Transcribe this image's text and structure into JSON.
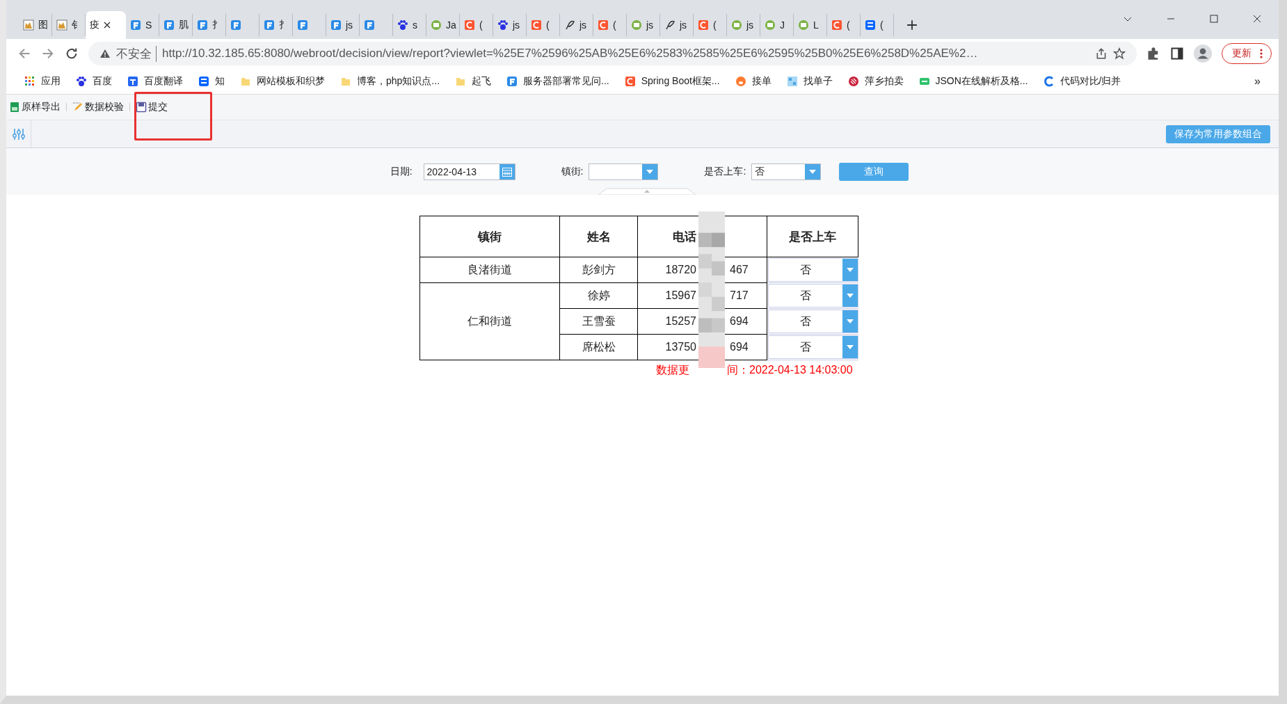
{
  "browser": {
    "tabs": [
      {
        "kind": "tomcat",
        "title": "图",
        "selected": false
      },
      {
        "kind": "tomcat",
        "title": "钅",
        "selected": false
      },
      {
        "title": "疫",
        "selected": true
      },
      {
        "kind": "fine",
        "title": "S",
        "selected": false
      },
      {
        "kind": "fine",
        "title": "肌",
        "selected": false
      },
      {
        "kind": "fine",
        "title": "扌",
        "selected": false
      },
      {
        "kind": "fine",
        "selected": false
      },
      {
        "kind": "fine",
        "title": "扌",
        "selected": false
      },
      {
        "kind": "fine",
        "selected": false
      },
      {
        "kind": "fine",
        "title": "js",
        "selected": false
      },
      {
        "kind": "fine",
        "selected": false
      },
      {
        "kind": "baidu",
        "title": "s",
        "selected": false
      },
      {
        "kind": "code",
        "title": "Ja",
        "selected": false
      },
      {
        "kind": "csdn",
        "title": "(",
        "selected": false
      },
      {
        "kind": "baidu",
        "title": "js",
        "selected": false
      },
      {
        "kind": "csdn",
        "title": "(",
        "selected": false
      },
      {
        "kind": "feather",
        "title": "js",
        "selected": false
      },
      {
        "kind": "csdn",
        "title": "(",
        "selected": false
      },
      {
        "kind": "code",
        "title": "js",
        "selected": false
      },
      {
        "kind": "feather",
        "title": "js",
        "selected": false
      },
      {
        "kind": "csdn",
        "title": "(",
        "selected": false
      },
      {
        "kind": "code",
        "title": "js",
        "selected": false
      },
      {
        "kind": "code",
        "title": "J",
        "selected": false
      },
      {
        "kind": "code",
        "title": "L",
        "selected": false
      },
      {
        "kind": "csdn",
        "title": "(",
        "selected": false
      },
      {
        "kind": "zhihu",
        "title": "(",
        "selected": false
      }
    ],
    "address_bar": {
      "security": "不安全",
      "url": "http://10.32.185.65:8080/webroot/decision/view/report?viewlet=%25E7%2596%25AB%25E6%2583%2585%25E6%2595%25B0%25E6%258D%25AE%2…"
    },
    "update_button": "更新",
    "bookmarks": [
      {
        "kind": "apps",
        "label": "应用"
      },
      {
        "kind": "baidu",
        "label": "百度"
      },
      {
        "kind": "translate",
        "label": "百度翻译"
      },
      {
        "kind": "zhihu",
        "label": "知"
      },
      {
        "kind": "folder",
        "label": "网站模板和织梦"
      },
      {
        "kind": "folder",
        "label": "博客，php知识点..."
      },
      {
        "kind": "folder",
        "label": "起飞"
      },
      {
        "kind": "fine",
        "label": "服务器部署常见问..."
      },
      {
        "kind": "csdn",
        "label": "Spring Boot框架..."
      },
      {
        "kind": "pig",
        "label": "接单"
      },
      {
        "kind": "grid",
        "label": "找单子"
      },
      {
        "kind": "auction",
        "label": "萍乡拍卖"
      },
      {
        "kind": "json",
        "label": "JSON在线解析及格..."
      },
      {
        "kind": "compare",
        "label": "代码对比/归并"
      }
    ],
    "bookmarks_overflow": "»"
  },
  "report": {
    "toolbar": [
      {
        "kind": "excel",
        "label": "原样导出"
      },
      {
        "kind": "pencil",
        "label": "数据校验"
      },
      {
        "kind": "save",
        "label": "提交"
      }
    ],
    "save_params_button": "保存为常用参数组合",
    "params": {
      "date": {
        "label": "日期:",
        "value": "2022-04-13"
      },
      "town": {
        "label": "镇街:"
      },
      "on_bus": {
        "label": "是否上车:",
        "value": "否"
      },
      "query_button": "查询"
    },
    "table": {
      "columns": [
        {
          "label": "镇街"
        },
        {
          "label": "姓名"
        },
        {
          "label": "电话"
        },
        {
          "label": "是否上车"
        }
      ],
      "groups": [
        {
          "town": "良渚街道",
          "people": [
            {
              "name": "彭剑方",
              "phone_parts": [
                "18720",
                "467"
              ],
              "on_bus": "否"
            }
          ]
        },
        {
          "town": "仁和街道",
          "people": [
            {
              "name": "徐婷",
              "phone_parts": [
                "15967",
                "717"
              ],
              "on_bus": "否"
            },
            {
              "name": "王雪蚕",
              "phone_parts": [
                "15257",
                "694"
              ],
              "on_bus": "否"
            },
            {
              "name": "席松松",
              "phone_parts": [
                "13750",
                "694"
              ],
              "on_bus": "否"
            }
          ]
        }
      ]
    },
    "updated_parts": [
      "数据更",
      "间：2022-04-13 14:03:00"
    ]
  }
}
